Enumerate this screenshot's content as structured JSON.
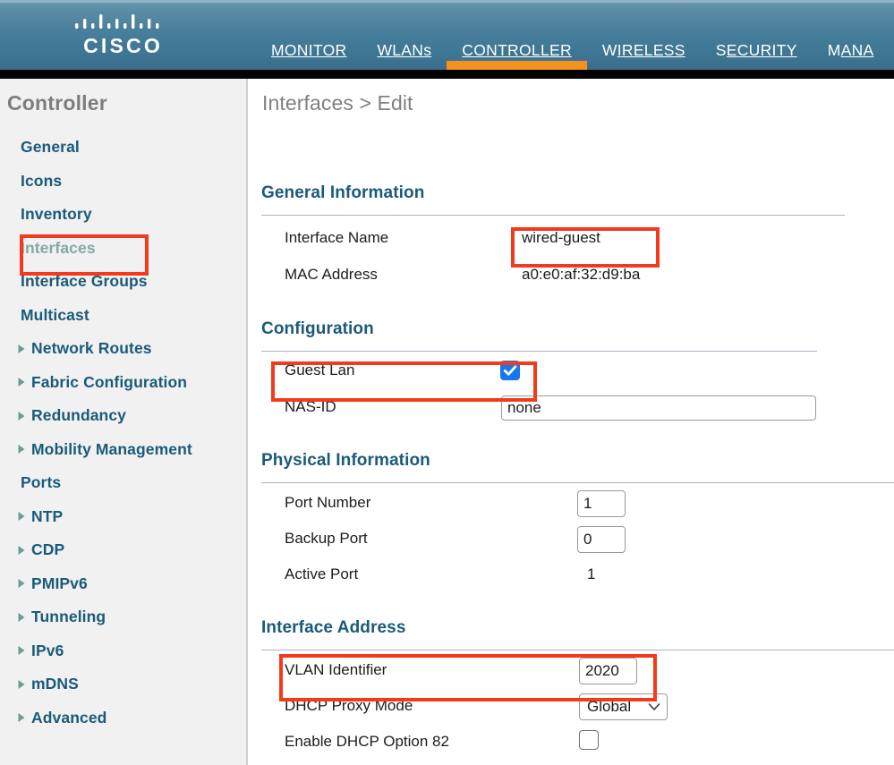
{
  "header": {
    "logo_word": "CISCO",
    "logo_icon": "cisco-bars-logo",
    "nav": [
      {
        "mnemonic": "M",
        "rest": "ONITOR",
        "full": "MONITOR",
        "active": false
      },
      {
        "mnemonic": "W",
        "rest": "LANs",
        "full": "WLANs",
        "active": false
      },
      {
        "mnemonic": "C",
        "rest": "ONTROLLER",
        "full": "CONTROLLER",
        "active": true
      },
      {
        "mnemonic": "I",
        "rest": "RELESS",
        "full": "WIRELESS",
        "active": false,
        "prefix": "W"
      },
      {
        "mnemonic": "E",
        "rest": "CURITY",
        "full": "SECURITY",
        "active": false,
        "prefix": "S"
      },
      {
        "mnemonic": "A",
        "rest": "NA",
        "full": "MANA",
        "active": false,
        "prefix": "M"
      }
    ]
  },
  "sidebar": {
    "title": "Controller",
    "items": [
      {
        "label": "General",
        "arrow": false,
        "selected": false
      },
      {
        "label": "Icons",
        "arrow": false,
        "selected": false
      },
      {
        "label": "Inventory",
        "arrow": false,
        "selected": false
      },
      {
        "label": "Interfaces",
        "arrow": false,
        "selected": true
      },
      {
        "label": "Interface Groups",
        "arrow": false,
        "selected": false
      },
      {
        "label": "Multicast",
        "arrow": false,
        "selected": false
      },
      {
        "label": "Network Routes",
        "arrow": true,
        "selected": false
      },
      {
        "label": "Fabric Configuration",
        "arrow": true,
        "selected": false
      },
      {
        "label": "Redundancy",
        "arrow": true,
        "selected": false
      },
      {
        "label": "Mobility Management",
        "arrow": true,
        "selected": false
      },
      {
        "label": "Ports",
        "arrow": false,
        "selected": false
      },
      {
        "label": "NTP",
        "arrow": true,
        "selected": false
      },
      {
        "label": "CDP",
        "arrow": true,
        "selected": false
      },
      {
        "label": "PMIPv6",
        "arrow": true,
        "selected": false
      },
      {
        "label": "Tunneling",
        "arrow": true,
        "selected": false
      },
      {
        "label": "IPv6",
        "arrow": true,
        "selected": false
      },
      {
        "label": "mDNS",
        "arrow": true,
        "selected": false
      },
      {
        "label": "Advanced",
        "arrow": true,
        "selected": false
      }
    ]
  },
  "main": {
    "breadcrumb": "Interfaces > Edit",
    "sections": {
      "general": {
        "heading": "General Information",
        "interface_name_label": "Interface Name",
        "interface_name_value": "wired-guest",
        "mac_address_label": "MAC Address",
        "mac_address_value": "a0:e0:af:32:d9:ba"
      },
      "configuration": {
        "heading": "Configuration",
        "guest_lan_label": "Guest Lan",
        "guest_lan_checked": "checked",
        "nas_id_label": "NAS-ID",
        "nas_id_value": "none"
      },
      "physical": {
        "heading": "Physical Information",
        "port_number_label": "Port Number",
        "port_number_value": "1",
        "backup_port_label": "Backup Port",
        "backup_port_value": "0",
        "active_port_label": "Active Port",
        "active_port_value": "1"
      },
      "address": {
        "heading": "Interface Address",
        "vlan_identifier_label": "VLAN Identifier",
        "vlan_identifier_value": "2020",
        "dhcp_proxy_mode_label": "DHCP Proxy Mode",
        "dhcp_proxy_mode_value": "Global",
        "dhcp_option82_label": "Enable DHCP Option 82",
        "dhcp_option82_checked": "unchecked"
      }
    }
  },
  "annotations": {
    "color": "#f33a1c",
    "boxes": [
      {
        "name": "interfaces-sidebar-highlight"
      },
      {
        "name": "interface-name-highlight"
      },
      {
        "name": "guest-lan-highlight"
      },
      {
        "name": "vlan-identifier-highlight"
      }
    ]
  }
}
